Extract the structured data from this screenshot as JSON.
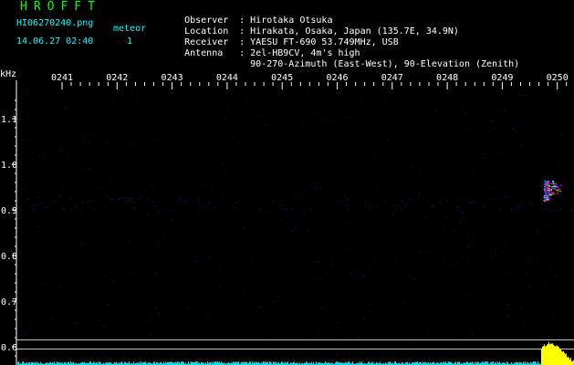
{
  "app": {
    "title": "HROFFT",
    "title_color": "#00ff00"
  },
  "file": {
    "name": "HI06270240.png",
    "timestamp": "14.06.27 02:40",
    "event_label": "meteor",
    "event_count": "1",
    "color": "#00ffff"
  },
  "station": {
    "color": "#ffffff",
    "lines": [
      {
        "key": "Observer",
        "value": "Hirotaka Otsuka"
      },
      {
        "key": "Location",
        "value": "Hirakata, Osaka, Japan (135.7E, 34.9N)"
      },
      {
        "key": "Receiver",
        "value": "YAESU FT-690 53.749MHz, USB"
      },
      {
        "key": "Antenna",
        "value": "2el-HB9CV, 4m's high"
      },
      {
        "key": "",
        "value": "90-270-Azimuth (East-West), 90-Elevation (Zenith)"
      }
    ]
  },
  "chart_data": {
    "type": "heatmap",
    "ylabel": "kHz",
    "ylim": [
      0.58,
      1.15
    ],
    "y_ticks": [
      "1.1",
      "1.0",
      "0.9",
      "0.8",
      "0.7",
      "0.6"
    ],
    "y_tick_values": [
      1.1,
      1.0,
      0.9,
      0.8,
      0.7,
      0.6
    ],
    "x_ticks": [
      "0241",
      "0242",
      "0243",
      "0244",
      "0245",
      "0246",
      "0247",
      "0248",
      "0249",
      "0250"
    ],
    "meteor_echo": {
      "time_minute": 8.8,
      "freq_khz": [
        0.92,
        0.965
      ]
    },
    "reference_lines_khz": [
      0.615,
      0.595
    ],
    "colors": {
      "axis": "#ffffff",
      "background": "#000000",
      "noise": "#1a1aa0",
      "echo_low": "#ff3333",
      "echo_high": "#00ffff",
      "spectrum": "#00e0e0",
      "spectrum_peak": "#ffff00"
    }
  }
}
